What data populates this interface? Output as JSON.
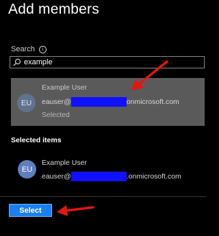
{
  "panel": {
    "title": "Add members"
  },
  "search": {
    "label": "Search",
    "value": "example",
    "info_icon": "info-icon",
    "icon": "search-icon"
  },
  "result": {
    "initials": "EU",
    "name": "Example User",
    "email_prefix": "eauser@",
    "email_suffix": "onmicrosoft.com",
    "status": "Selected"
  },
  "selected_items": {
    "heading": "Selected items",
    "items": [
      {
        "initials": "EU",
        "name": "Example User",
        "email_prefix": "eauser@",
        "email_suffix": ".onmicrosoft.com"
      }
    ]
  },
  "footer": {
    "select_label": "Select"
  },
  "colors": {
    "background": "#000000",
    "selected_card": "#5a5a5a",
    "primary_button": "#1a7ff0",
    "redaction": "#1010ff",
    "annotation_arrow": "#e8140c"
  }
}
